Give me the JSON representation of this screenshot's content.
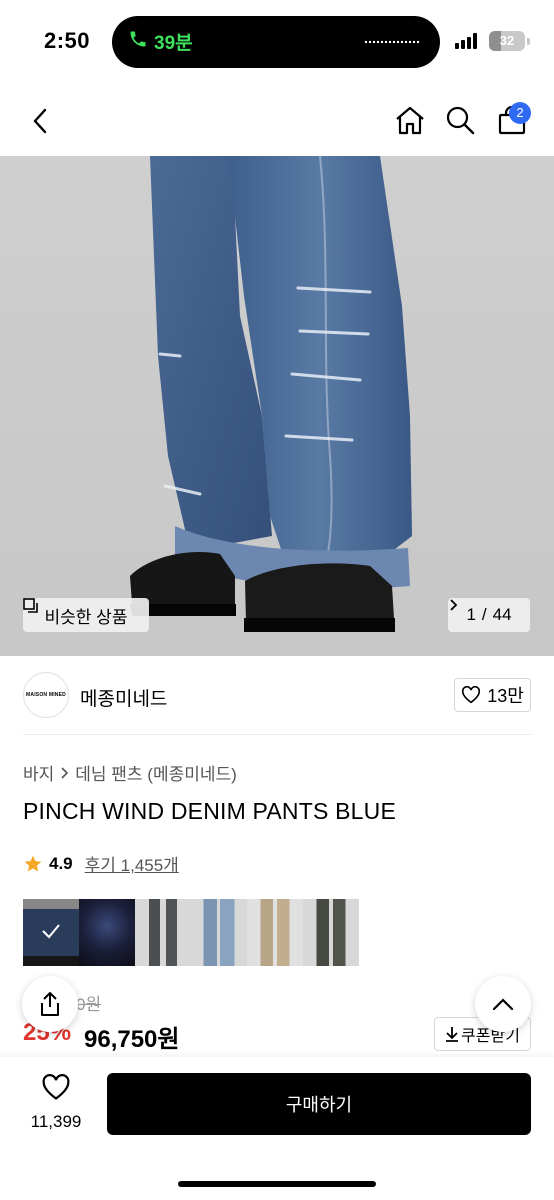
{
  "status_bar": {
    "time": "2:50",
    "call_duration": "39분",
    "battery": "32",
    "battery_level_percent": 32,
    "accent_green": "#3ee05c"
  },
  "nav": {
    "back_icon": "chevron-left-icon",
    "home_icon": "home-icon",
    "search_icon": "search-icon",
    "cart_icon": "shopping-bag-icon",
    "cart_badge": "2",
    "badge_color": "#2f6bf2"
  },
  "gallery": {
    "similar_label": "비슷한 상품",
    "counter_current": "1",
    "counter_separator": "/",
    "counter_total": "44"
  },
  "brand": {
    "logo_text": "MAISON MINED",
    "name": "메종미네드",
    "likes": "13만"
  },
  "product": {
    "breadcrumb": [
      "바지",
      "데님 팬츠 (메종미네드)"
    ],
    "title": "PINCH WIND DENIM PANTS BLUE",
    "rating": "4.9",
    "reviews": "후기 1,455개",
    "rating_color": "#f5a623"
  },
  "price": {
    "original_partial": "0원",
    "discount": "25%",
    "sale_price": "96,750원",
    "coupon_label": "쿠폰받기",
    "discount_color": "#e0322c"
  },
  "bottom_bar": {
    "wish_count": "11,399",
    "buy_label": "구매하기"
  }
}
